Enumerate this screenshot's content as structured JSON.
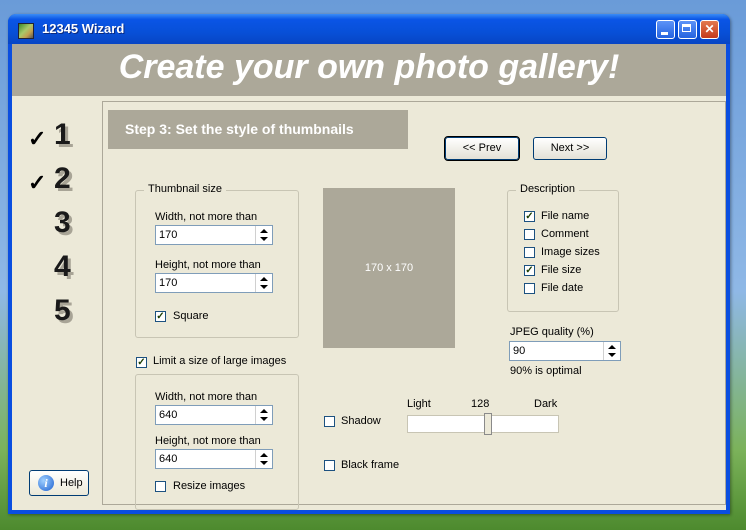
{
  "window": {
    "title": "12345 Wizard"
  },
  "banner": {
    "title": "Create your own photo gallery!"
  },
  "steps": [
    {
      "number": "1",
      "done": true
    },
    {
      "number": "2",
      "done": true
    },
    {
      "number": "3",
      "done": false
    },
    {
      "number": "4",
      "done": false
    },
    {
      "number": "5",
      "done": false
    }
  ],
  "step_header": "Step 3:  Set the style of  thumbnails",
  "nav": {
    "prev": "<< Prev",
    "next": "Next >>"
  },
  "help": {
    "label": "Help"
  },
  "thumbnail": {
    "title": "Thumbnail size",
    "width_label": "Width, not more than",
    "width_value": "170",
    "height_label": "Height, not more than",
    "height_value": "170",
    "square_label": "Square",
    "square_checked": true
  },
  "limit": {
    "label": "Limit a size of large images",
    "checked": true,
    "width_label": "Width, not more than",
    "width_value": "640",
    "height_label": "Height, not more than",
    "height_value": "640",
    "resize_label": "Resize images",
    "resize_checked": false
  },
  "preview": {
    "text": "170 x 170"
  },
  "description": {
    "title": "Description",
    "items": [
      {
        "label": "File name",
        "checked": true
      },
      {
        "label": "Comment",
        "checked": false
      },
      {
        "label": "Image sizes",
        "checked": false
      },
      {
        "label": "File size",
        "checked": true
      },
      {
        "label": "File date",
        "checked": false
      }
    ]
  },
  "jpeg": {
    "label": "JPEG quality (%)",
    "value": "90",
    "hint": "90% is optimal"
  },
  "shadow": {
    "label": "Shadow",
    "checked": false,
    "light_label": "Light",
    "dark_label": "Dark",
    "value": "128"
  },
  "black_frame": {
    "label": "Black frame",
    "checked": false
  }
}
